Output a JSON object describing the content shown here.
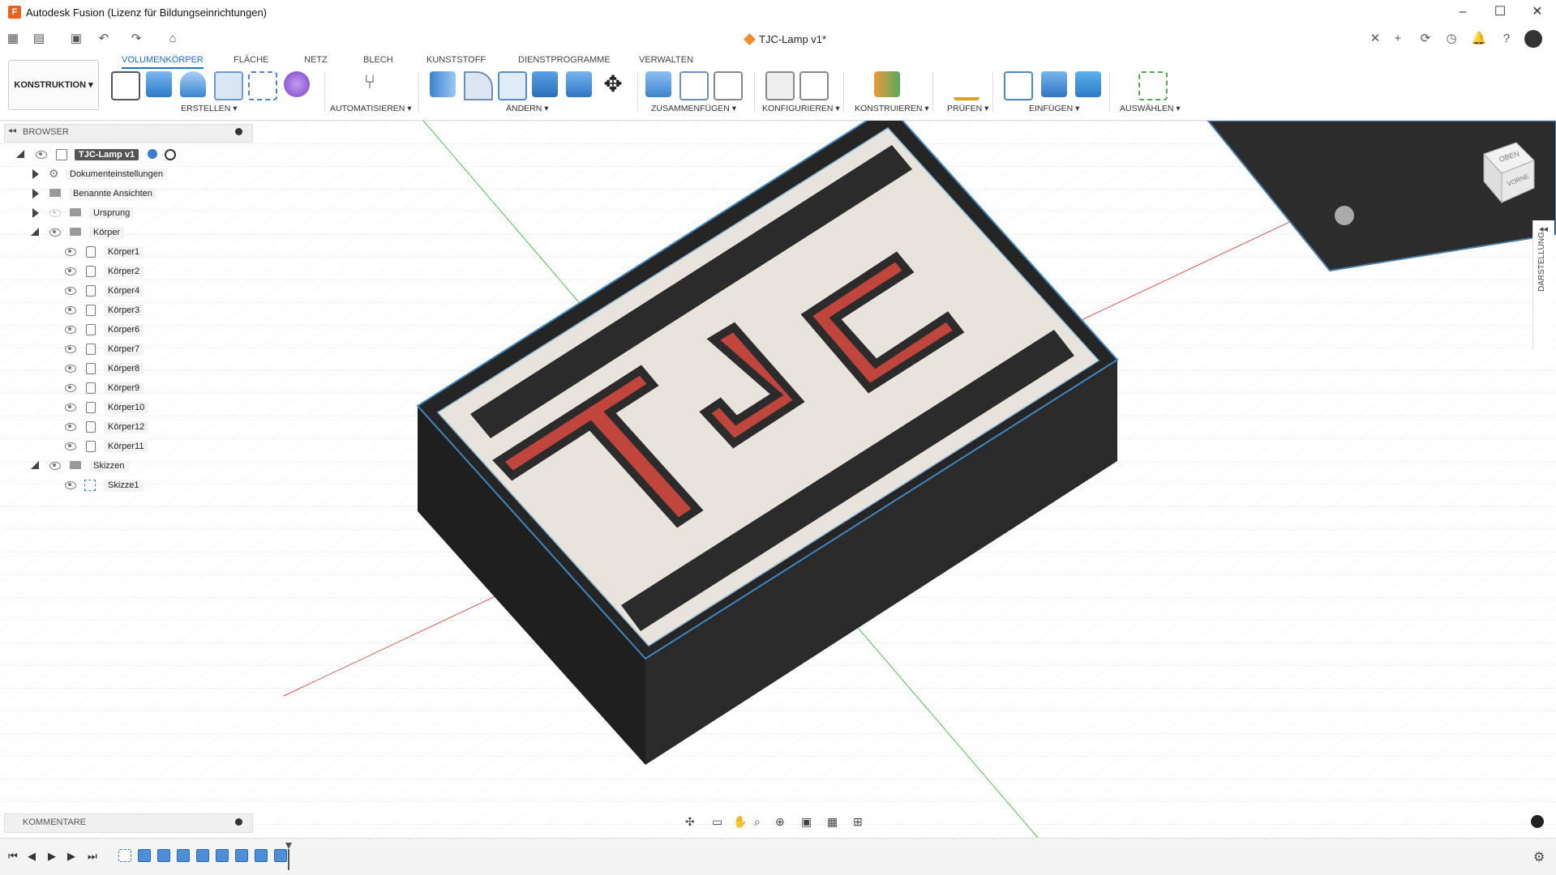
{
  "window": {
    "title": "Autodesk Fusion (Lizenz für Bildungseinrichtungen)",
    "controls": [
      "–",
      "☐",
      "✕"
    ]
  },
  "document": {
    "tab_title": "TJC-Lamp v1*",
    "close": "✕"
  },
  "ribbon": {
    "workspace": "KONSTRUKTION",
    "tabs": [
      "VOLUMENKÖRPER",
      "FLÄCHE",
      "NETZ",
      "BLECH",
      "KUNSTSTOFF",
      "DIENSTPROGRAMME",
      "VERWALTEN"
    ],
    "active_tab": "VOLUMENKÖRPER",
    "groups": [
      "ERSTELLEN ▾",
      "AUTOMATISIEREN ▾",
      "ÄNDERN ▾",
      "ZUSAMMENFÜGEN ▾",
      "KONFIGURIEREN ▾",
      "KONSTRUIEREN ▾",
      "PRÜFEN ▾",
      "EINFÜGEN ▾",
      "AUSWÄHLEN ▾"
    ]
  },
  "browser": {
    "title": "BROWSER",
    "root": "TJC-Lamp v1",
    "items": [
      {
        "label": "Dokumenteinstellungen"
      },
      {
        "label": "Benannte Ansichten"
      },
      {
        "label": "Ursprung"
      },
      {
        "label": "Körper"
      },
      {
        "label": "Körper1"
      },
      {
        "label": "Körper2"
      },
      {
        "label": "Körper4"
      },
      {
        "label": "Körper3"
      },
      {
        "label": "Körper6"
      },
      {
        "label": "Körper7"
      },
      {
        "label": "Körper8"
      },
      {
        "label": "Körper9"
      },
      {
        "label": "Körper10"
      },
      {
        "label": "Körper12"
      },
      {
        "label": "Körper11"
      },
      {
        "label": "Skizzen"
      },
      {
        "label": "Skizze1"
      }
    ]
  },
  "comments": {
    "title": "KOMMENTARE"
  },
  "side_panel": {
    "label": "DARSTELLUNG"
  },
  "viewcube": {
    "faces": [
      "OBEN",
      "VORNE"
    ]
  },
  "colors": {
    "accent": "#1b6fd1",
    "model_dark": "#2b2b2b",
    "model_face": "#e8e4dc",
    "logo_red": "#c0463d"
  }
}
